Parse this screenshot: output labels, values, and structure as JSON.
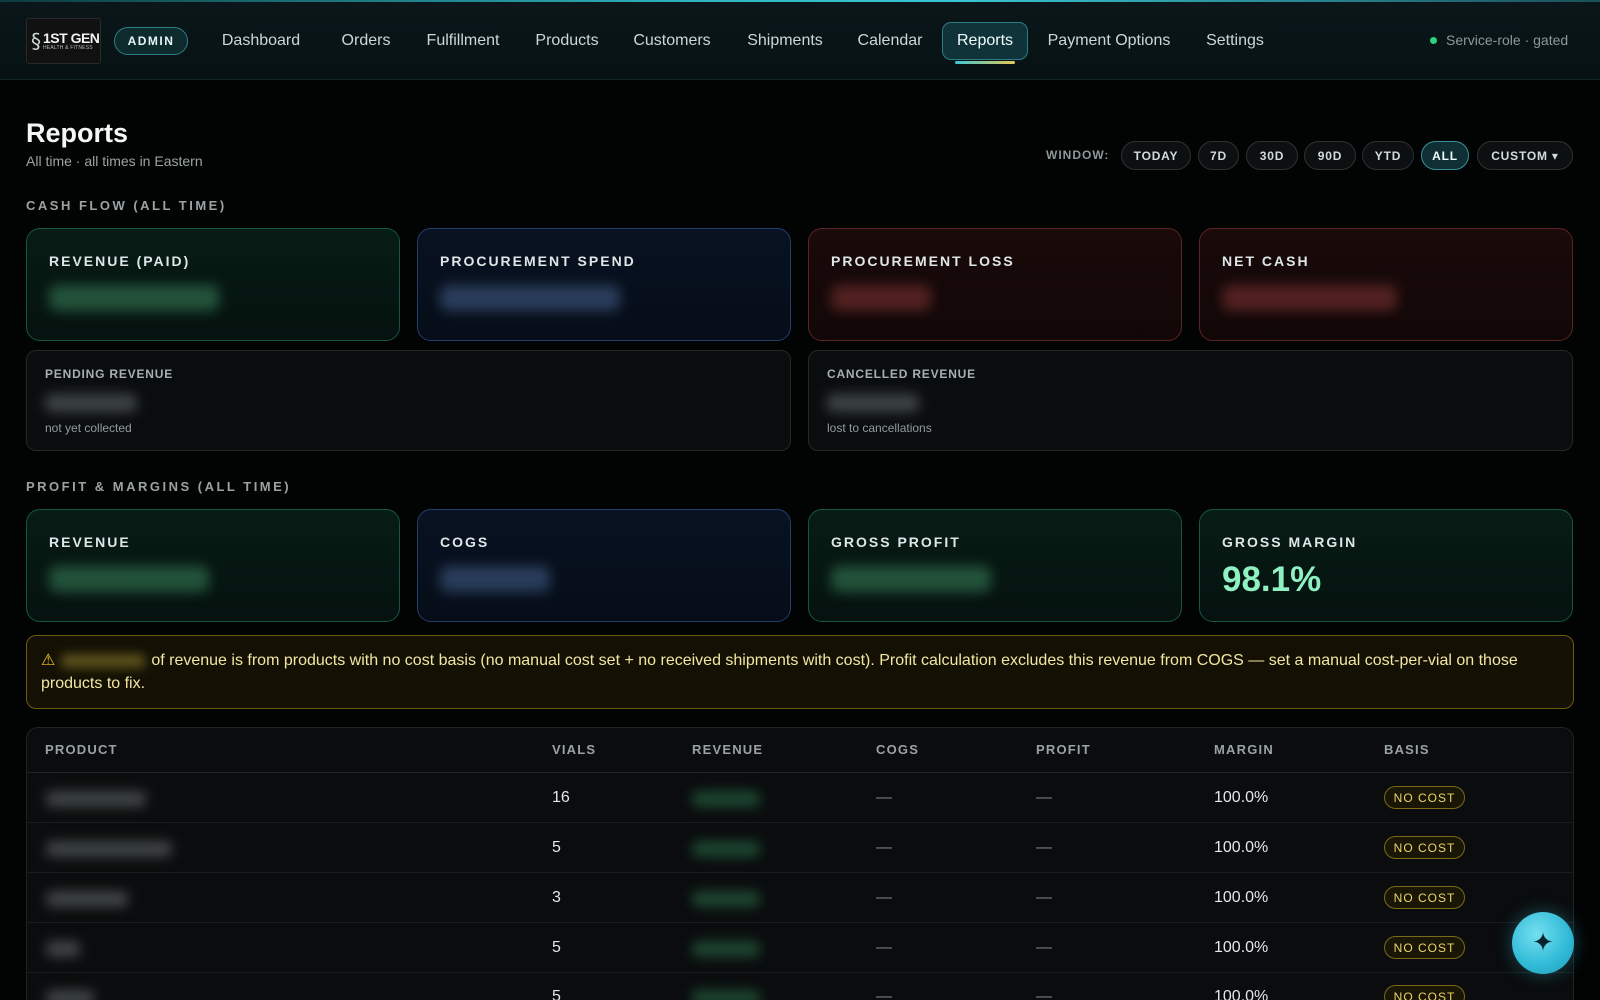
{
  "header": {
    "logo": {
      "line1": "1ST GEN",
      "line2": "HEALTH & FITNESS",
      "icon": "dna-icon"
    },
    "role_badge": "ADMIN",
    "nav": [
      {
        "label": "Dashboard"
      },
      {
        "label": "Orders"
      },
      {
        "label": "Fulfillment"
      },
      {
        "label": "Products"
      },
      {
        "label": "Customers"
      },
      {
        "label": "Shipments"
      },
      {
        "label": "Calendar"
      },
      {
        "label": "Reports",
        "active": true
      },
      {
        "label": "Payment Options"
      },
      {
        "label": "Settings"
      }
    ],
    "service_status": "Service-role · gated",
    "status_color": "#2ed17d"
  },
  "page": {
    "title": "Reports",
    "subtitle": "All time · all times in Eastern"
  },
  "window": {
    "label": "WINDOW:",
    "options": [
      "TODAY",
      "7D",
      "30D",
      "90D",
      "YTD",
      "ALL",
      "CUSTOM ▾"
    ],
    "selected": "ALL"
  },
  "cash_flow": {
    "title": "CASH FLOW (ALL TIME)",
    "cards": [
      {
        "label": "REVENUE (PAID)"
      },
      {
        "label": "PROCUREMENT SPEND"
      },
      {
        "label": "PROCUREMENT LOSS"
      },
      {
        "label": "NET CASH"
      }
    ],
    "pending": {
      "label": "PENDING REVENUE",
      "note": "not yet collected"
    },
    "cancelled": {
      "label": "CANCELLED REVENUE",
      "note": "lost to cancellations"
    }
  },
  "profit": {
    "title": "PROFIT & MARGINS (ALL TIME)",
    "cards": [
      {
        "label": "REVENUE"
      },
      {
        "label": "COGS"
      },
      {
        "label": "GROSS PROFIT"
      },
      {
        "label": "GROSS MARGIN",
        "value": "98.1%"
      }
    ]
  },
  "warning": {
    "icon": "warning-icon",
    "text": "of revenue is from products with no cost basis (no manual cost set + no received shipments with cost). Profit calculation excludes this revenue from COGS — set a manual cost-per-vial on those products to fix."
  },
  "table": {
    "columns": [
      "PRODUCT",
      "VIALS",
      "REVENUE",
      "COGS",
      "PROFIT",
      "MARGIN",
      "BASIS"
    ],
    "rows": [
      {
        "vials": "16",
        "cogs": "—",
        "profit": "—",
        "margin": "100.0%",
        "basis": "NO COST"
      },
      {
        "vials": "5",
        "cogs": "—",
        "profit": "—",
        "margin": "100.0%",
        "basis": "NO COST"
      },
      {
        "vials": "3",
        "cogs": "—",
        "profit": "—",
        "margin": "100.0%",
        "basis": "NO COST"
      },
      {
        "vials": "5",
        "cogs": "—",
        "profit": "—",
        "margin": "100.0%",
        "basis": "NO COST"
      },
      {
        "vials": "5",
        "cogs": "—",
        "profit": "—",
        "margin": "100.0%",
        "basis": "NO COST"
      }
    ]
  },
  "fab": {
    "icon": "sparkle-icon"
  }
}
